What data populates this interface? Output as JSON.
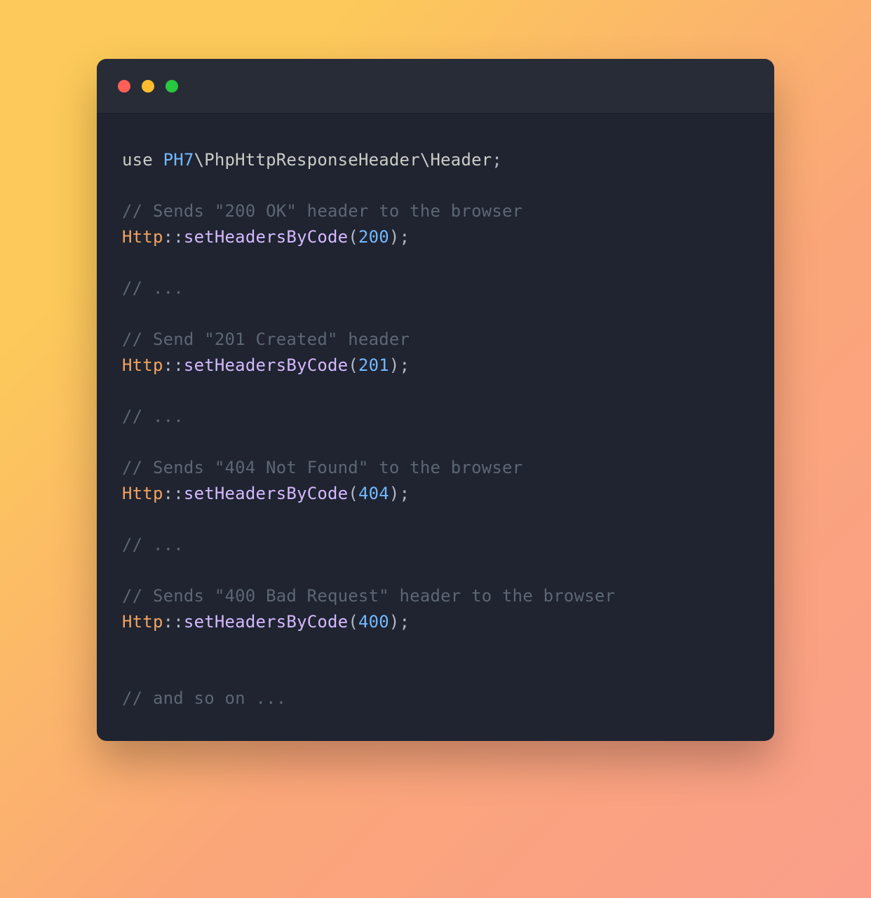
{
  "background": {
    "gradient_from": "#fcc95a",
    "gradient_to": "#fa9e8a"
  },
  "window": {
    "traffic_lights": {
      "red": "#ff5f57",
      "yellow": "#febc2e",
      "green": "#28c840"
    },
    "bg": "#1f2430",
    "titlebar_bg": "#282c36"
  },
  "code": {
    "use_kw": "use ",
    "namespace": "PH7",
    "namespace_path": "\\PhpHttpResponseHeader\\Header",
    "semi": ";",
    "comment_200": "// Sends \"200 OK\" header to the browser",
    "cls": "Http",
    "dcolon": "::",
    "method": "setHeadersByCode",
    "open": "(",
    "close": ")",
    "n200": "200",
    "ellipsis": "// ...",
    "comment_201": "// Send \"201 Created\" header",
    "n201": "201",
    "comment_404": "// Sends \"404 Not Found\" to the browser",
    "n404": "404",
    "comment_400": "// Sends \"400 Bad Request\" header to the browser",
    "n400": "400",
    "comment_end": "// and so on ..."
  }
}
